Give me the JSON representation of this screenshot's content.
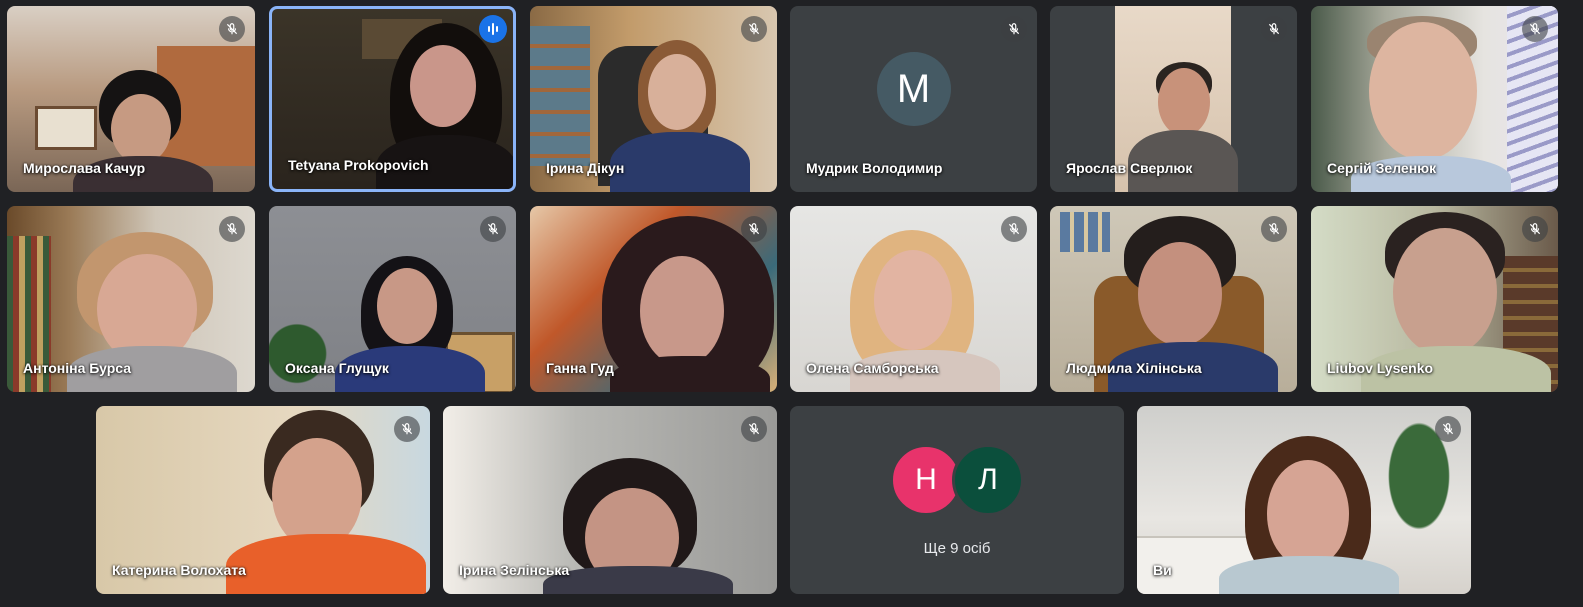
{
  "colors": {
    "background": "#202124",
    "speaking_border": "#8ab4f8",
    "avatar_m": "#455a64",
    "avatar_n": "#e8336b",
    "avatar_l": "#0b4f3c"
  },
  "participants": [
    {
      "name": "Мирослава Качур",
      "muted": true
    },
    {
      "name": "Tetyana Prokopovich",
      "muted": false,
      "speaking": true
    },
    {
      "name": "Ірина Дікун",
      "muted": true
    },
    {
      "name": "Мудрик Володимир",
      "muted": true,
      "avatar_letter": "M"
    },
    {
      "name": "Ярослав Сверлюк",
      "muted": true
    },
    {
      "name": "Сергій Зеленюк",
      "muted": true
    },
    {
      "name": "Антоніна Бурса",
      "muted": true
    },
    {
      "name": "Оксана Глущук",
      "muted": true
    },
    {
      "name": "Ганна Гуд",
      "muted": true
    },
    {
      "name": "Олена Самборська",
      "muted": true
    },
    {
      "name": "Людмила Хілінська",
      "muted": true
    },
    {
      "name": "Liubov Lysenko",
      "muted": true
    },
    {
      "name": "Катерина Волохата",
      "muted": true
    },
    {
      "name": "Ірина Зелінська",
      "muted": true
    },
    {
      "name": "Ви",
      "muted": true
    }
  ],
  "more_tile": {
    "avatars": [
      "Н",
      "Л"
    ],
    "label": "Ще 9 осіб"
  },
  "icons": {
    "muted": "mic-off-icon",
    "speaking": "audio-wave-icon"
  }
}
